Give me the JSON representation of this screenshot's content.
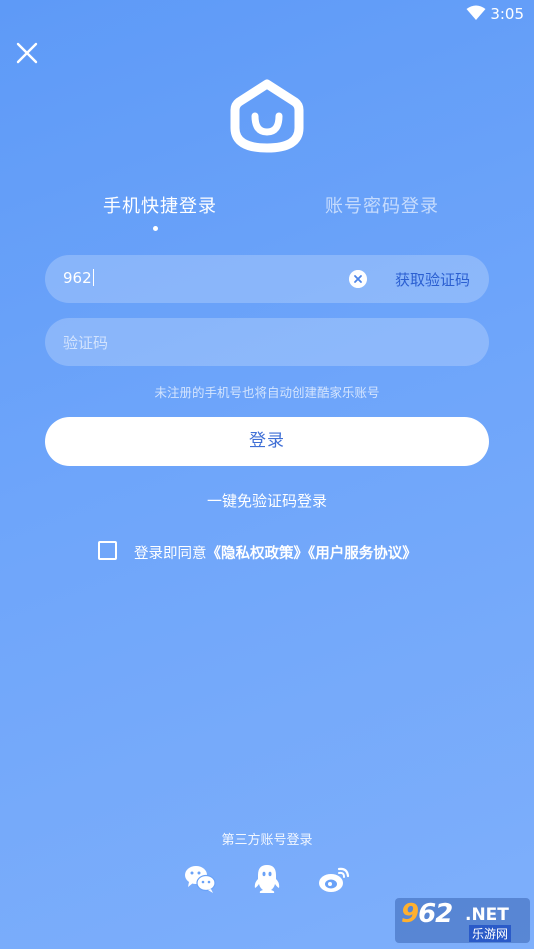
{
  "status_bar": {
    "time": "3:05"
  },
  "tabs": [
    {
      "label": "手机快捷登录",
      "active": true
    },
    {
      "label": "账号密码登录",
      "active": false
    }
  ],
  "phone_input": {
    "value": "962"
  },
  "get_code_label": "获取验证码",
  "code_input": {
    "placeholder": "验证码"
  },
  "hint_text": "未注册的手机号也将自动创建酷家乐账号",
  "login_button_label": "登录",
  "quick_login_label": "一键免验证码登录",
  "agreement": {
    "prefix": "登录即同意",
    "privacy_link": "《隐私权政策》",
    "terms_link": "《用户服务协议》",
    "checked": false
  },
  "third_party": {
    "label": "第三方账号登录",
    "providers": [
      "wechat-icon",
      "qq-icon",
      "weibo-icon"
    ]
  },
  "watermark": {
    "brand_num_orange": "9",
    "brand_num_white": "62",
    "brand_net": ".NET",
    "brand_sub": "乐游网"
  },
  "colors": {
    "background": "#6ea5fa",
    "accent_text": "#2b5fd1",
    "button_text": "#3f6fd6"
  }
}
